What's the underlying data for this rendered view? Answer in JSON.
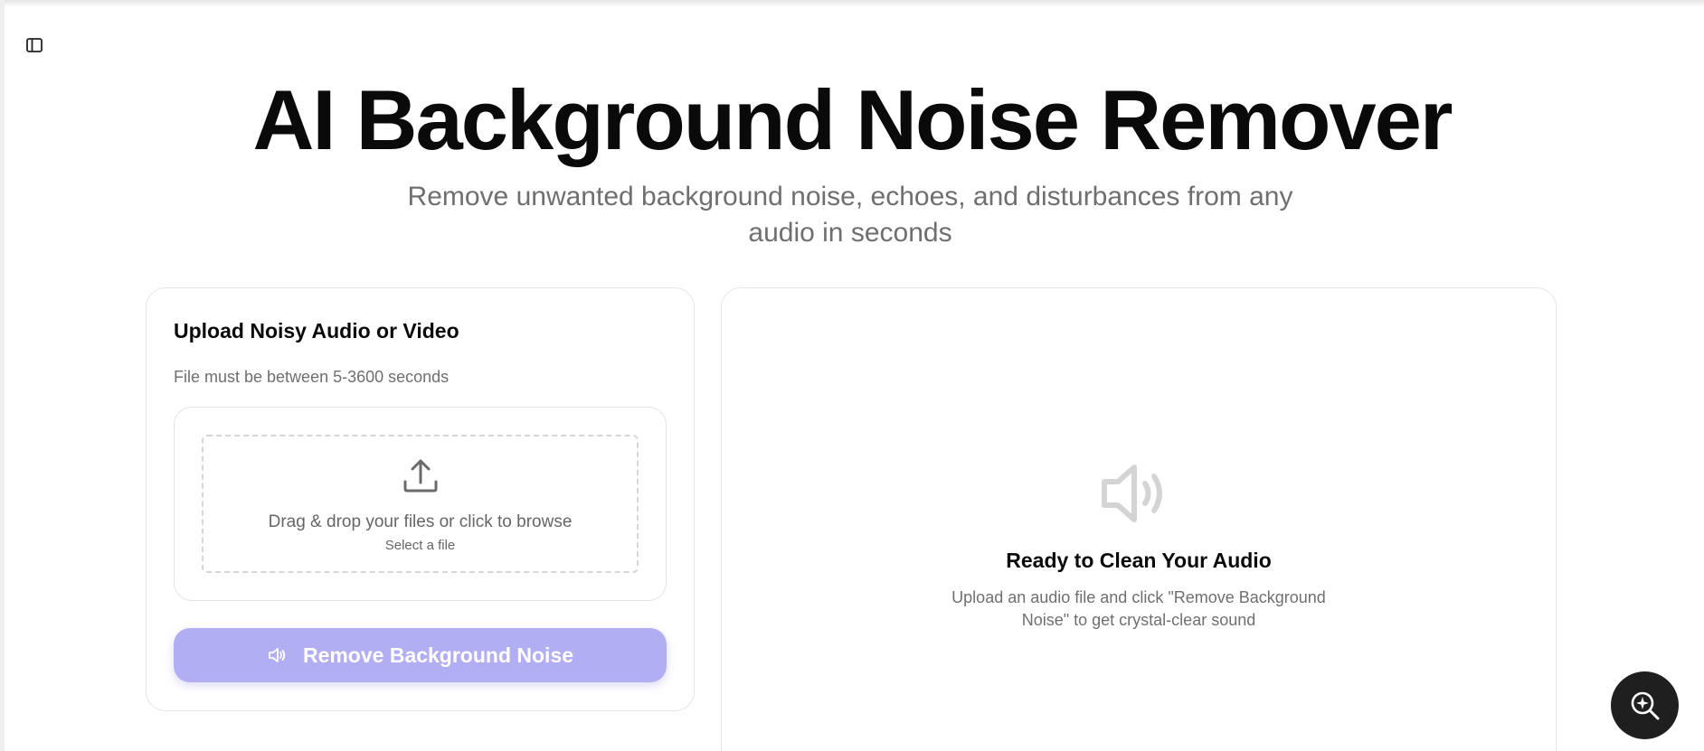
{
  "sidebar": {
    "toggle_icon": "sidebar-panel-icon"
  },
  "hero": {
    "title": "AI Background Noise Remover",
    "subtitle": "Remove unwanted background noise, echoes, and disturbances from any audio in seconds"
  },
  "upload": {
    "title": "Upload Noisy Audio or Video",
    "note": "File must be between 5-3600 seconds",
    "drop_text": "Drag & drop your files or click to browse",
    "select_file": "Select a file",
    "upload_icon": "upload-icon",
    "button_label": "Remove Background Noise",
    "button_icon": "speaker-icon"
  },
  "result": {
    "icon": "speaker-volume-icon",
    "title": "Ready to Clean Your Audio",
    "description": "Upload an audio file and click \"Remove Background Noise\" to get crystal-clear sound"
  },
  "fab": {
    "icon": "search-sparkle-icon"
  },
  "colors": {
    "accent_disabled": "#b2aef3",
    "text_muted": "#6f6f6f",
    "fab_bg": "#1f1f1f"
  }
}
